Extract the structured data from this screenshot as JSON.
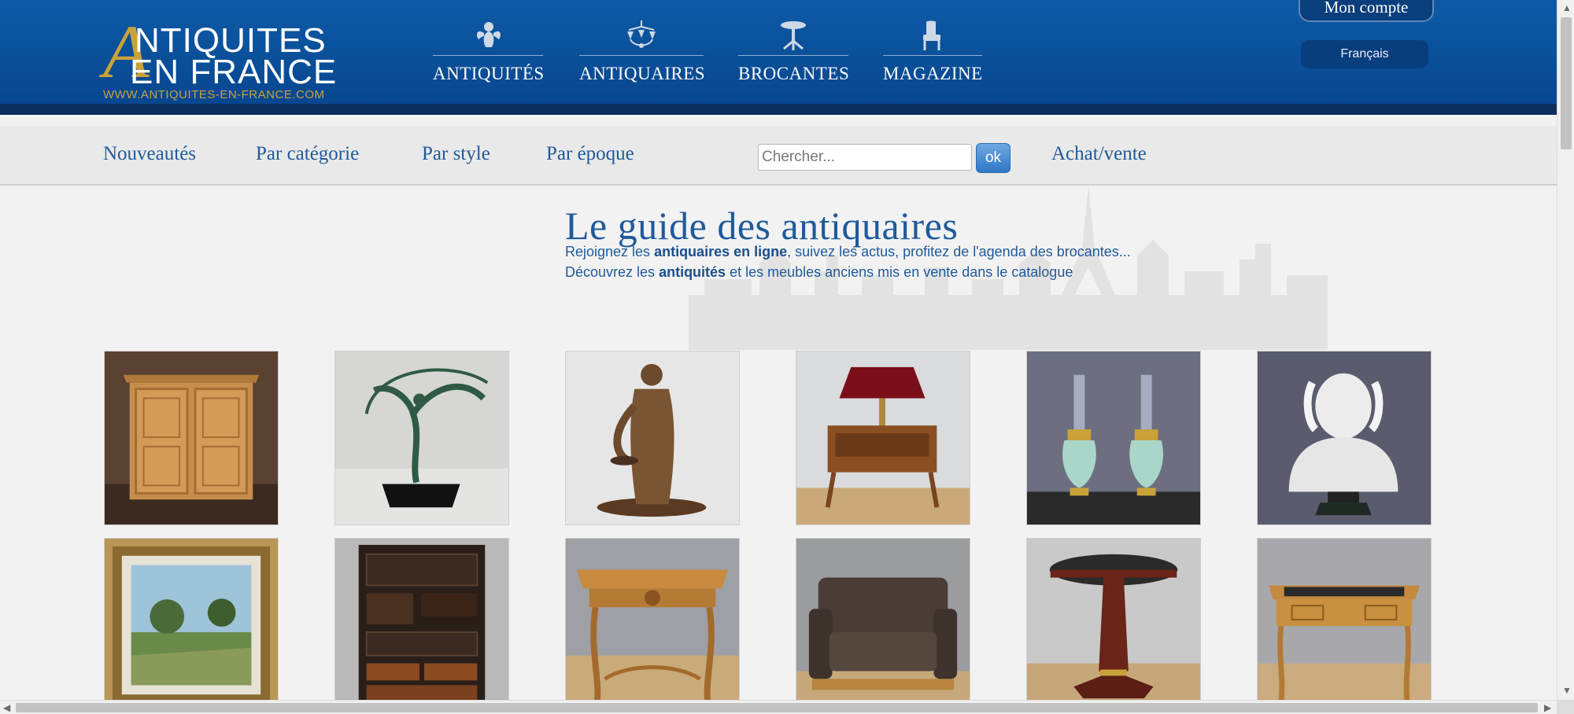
{
  "header": {
    "logo": {
      "big_letter": "A",
      "line1": "NTIQUITES",
      "line2": "EN FRANCE",
      "url": "WWW.ANTIQUITES-EN-FRANCE.COM"
    },
    "main_nav": [
      {
        "label": "ANTIQUITÉS",
        "icon": "cherub-icon"
      },
      {
        "label": "ANTIQUAIRES",
        "icon": "chandelier-icon"
      },
      {
        "label": "BROCANTES",
        "icon": "pedestal-table-icon"
      },
      {
        "label": "MAGAZINE",
        "icon": "armchair-icon"
      }
    ],
    "account_label": "Mon compte",
    "language_label": "Français"
  },
  "subnav": {
    "links": [
      "Nouveautés",
      "Par catégorie",
      "Par style",
      "Par époque"
    ],
    "search_placeholder": "Chercher...",
    "search_button": "ok",
    "trade_link": "Achat/vente"
  },
  "hero": {
    "title": "Le guide des antiquaires",
    "line1_a": "Rejoignez les ",
    "line1_b": "antiquaires en ligne",
    "line1_c": ", suivez les actus, profitez de l'agenda des brocantes...",
    "line2_a": "Découvrez les ",
    "line2_b": "antiquités",
    "line2_c": " et les meubles anciens mis en vente dans le catalogue"
  },
  "products": [
    {
      "subject": "wooden-armoire"
    },
    {
      "subject": "bronze-dancer-statue"
    },
    {
      "subject": "bronze-figure-statue"
    },
    {
      "subject": "bouillotte-lamp-on-desk"
    },
    {
      "subject": "pair-of-oil-lamps"
    },
    {
      "subject": "marble-bust"
    },
    {
      "subject": "framed-landscape-painting"
    },
    {
      "subject": "carved-lacquer-cabinet"
    },
    {
      "subject": "carved-side-table"
    },
    {
      "subject": "leather-sofa"
    },
    {
      "subject": "round-pedestal-table"
    },
    {
      "subject": "writing-desk"
    }
  ],
  "colors": {
    "header_blue": "#0a4f98",
    "gold": "#c9a23a",
    "link_blue": "#1f5a9a"
  }
}
